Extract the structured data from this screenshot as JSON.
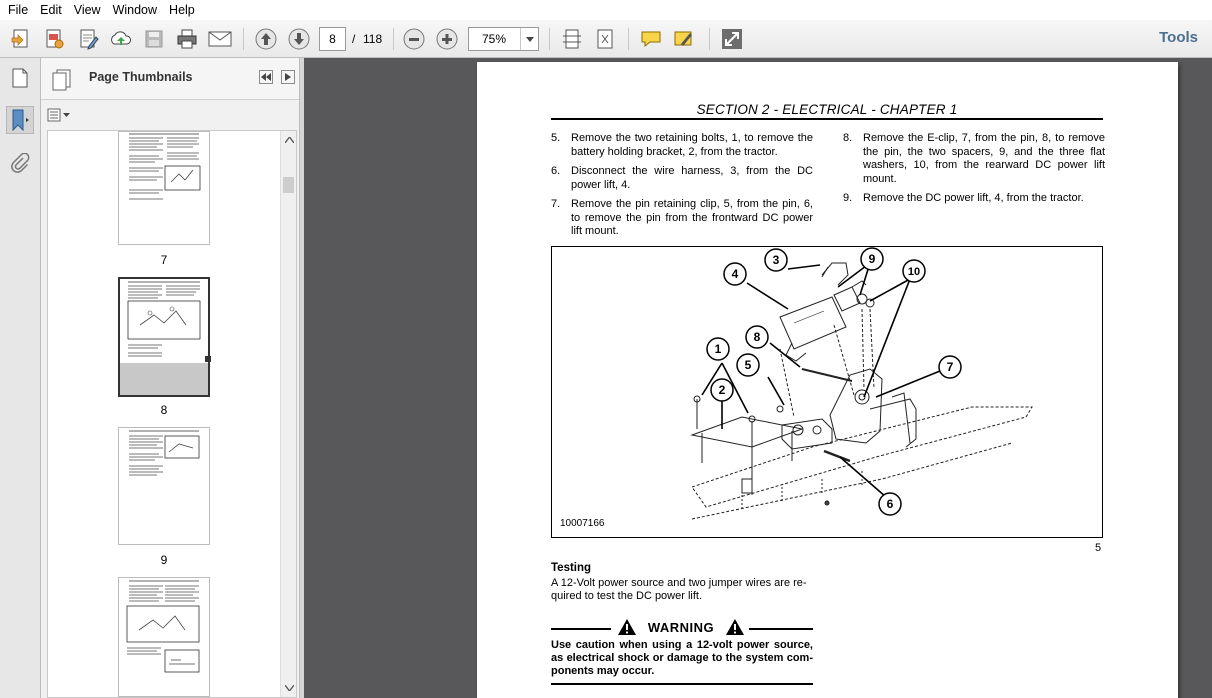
{
  "menu": [
    "File",
    "Edit",
    "View",
    "Window",
    "Help"
  ],
  "toolbar": {
    "current_page": "8",
    "page_separator": "/",
    "total_pages": "118",
    "zoom": "75%",
    "tools_label": "Tools"
  },
  "panel": {
    "title": "Page Thumbnails",
    "thumbnails": [
      {
        "label": "7"
      },
      {
        "label": "8"
      },
      {
        "label": "9"
      },
      {
        "label": ""
      }
    ]
  },
  "document": {
    "section_title": "SECTION 2 - ELECTRICAL - CHAPTER 1",
    "steps_left": [
      {
        "num": "5.",
        "text": "Remove the two retaining bolts, 1, to remove the battery holding bracket, 2, from the tractor."
      },
      {
        "num": "6.",
        "text": "Disconnect the wire harness, 3, from the DC power lift, 4."
      },
      {
        "num": "7.",
        "text": "Remove the pin retaining clip, 5, from the pin, 6, to remove the pin from the frontward DC power lift mount."
      }
    ],
    "steps_right": [
      {
        "num": "8.",
        "text": "Remove the E-clip, 7, from the pin, 8, to remove the pin, the two spacers, 9, and the three flat washers, 10, from the rearward DC power lift mount."
      },
      {
        "num": "9.",
        "text": "Remove the DC power lift, 4, from the tractor."
      }
    ],
    "figure": {
      "id": "10007166",
      "number": "5",
      "callouts": [
        "1",
        "2",
        "3",
        "4",
        "5",
        "6",
        "7",
        "8",
        "9",
        "10"
      ]
    },
    "testing_heading": "Testing",
    "testing_body": "A 12-Volt power source and two jumper wires are re-quired to test the DC power lift.",
    "warning_title": "WARNING",
    "warning_body": "Use caution when using a 12-volt power source, as electrical shock or damage to the system com-ponents may occur."
  }
}
